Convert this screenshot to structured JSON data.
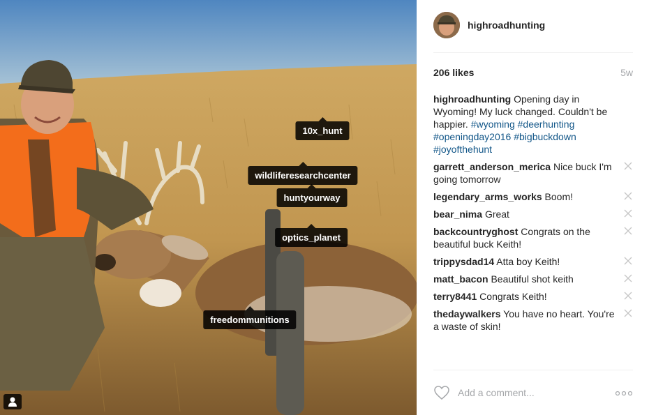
{
  "post": {
    "username": "highroadhunting",
    "likes": "206 likes",
    "age": "5w",
    "caption": {
      "username": "highroadhunting",
      "text": "Opening day in Wyoming! My luck changed. Couldn't be happier.",
      "hashtags": [
        "#wyoming",
        "#deerhunting",
        "#openingday2016",
        "#bigbuckdown",
        "#joyofthehunt"
      ]
    }
  },
  "photo": {
    "tags": [
      "10x_hunt",
      "wildliferesearchcenter",
      "huntyourway",
      "optics_planet",
      "freedommunitions"
    ],
    "user_tag_icon": "person-icon"
  },
  "comments": [
    {
      "user": "garrett_anderson_merica",
      "text": "Nice buck I'm going tomorrow"
    },
    {
      "user": "legendary_arms_works",
      "text": "Boom!"
    },
    {
      "user": "bear_nima",
      "text": "Great"
    },
    {
      "user": "backcountryghost",
      "text": "Congrats on the beautiful buck Keith!"
    },
    {
      "user": "trippysdad14",
      "text": "Atta boy Keith!"
    },
    {
      "user": "matt_bacon",
      "text": "Beautiful shot keith"
    },
    {
      "user": "terry8441",
      "text": "Congrats Keith!"
    },
    {
      "user": "thedaywalkers",
      "text": "You have no heart. You're a waste of skin!"
    }
  ],
  "footer": {
    "comment_placeholder": "Add a comment...",
    "like_icon": "heart-icon",
    "more_icon": "more-options-icon"
  },
  "colors": {
    "hashtag": "#125688",
    "muted": "#a5a7aa",
    "text": "#262626",
    "tag_bg": "#000000"
  }
}
